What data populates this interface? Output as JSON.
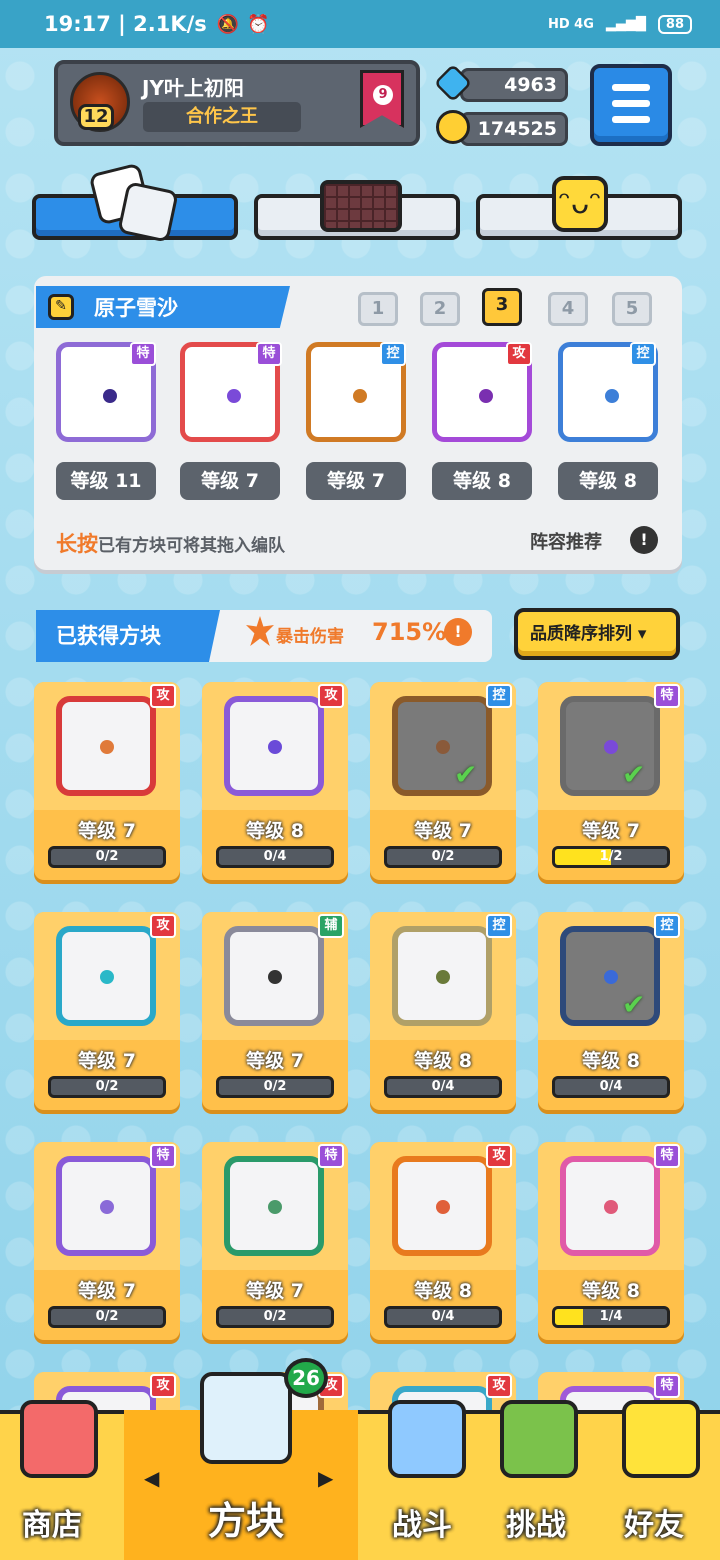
{
  "status": {
    "time_speed": "19:17 | 2.1K/s",
    "network": "HD 4G",
    "battery": "88"
  },
  "profile": {
    "name": "JY叶上初阳",
    "title": "合作之王",
    "level": "12",
    "rank": "9"
  },
  "currency": {
    "gems": "4963",
    "coins": "174525"
  },
  "deck": {
    "name": "原子雪沙",
    "pages": [
      "1",
      "2",
      "3",
      "4",
      "5"
    ],
    "selected_page": "3",
    "slots": [
      {
        "tag": "特",
        "level": "等级 11"
      },
      {
        "tag": "特",
        "level": "等级 7"
      },
      {
        "tag": "控",
        "level": "等级 7"
      },
      {
        "tag": "攻",
        "level": "等级 8"
      },
      {
        "tag": "控",
        "level": "等级 8"
      }
    ],
    "hint_key": "长按",
    "hint_text": "已有方块可将其拖入编队",
    "recommend": "阵容推荐"
  },
  "owned": {
    "title": "已获得方块",
    "crit_label": "暴击伤害",
    "crit_value": "715%",
    "sort": "品质降序排列 ▾"
  },
  "cards": [
    {
      "tag": "攻",
      "level": "等级 7",
      "progress": "0/2"
    },
    {
      "tag": "攻",
      "level": "等级 8",
      "progress": "0/4"
    },
    {
      "tag": "控",
      "level": "等级 7",
      "progress": "0/2"
    },
    {
      "tag": "特",
      "level": "等级 7",
      "progress": "1/2"
    },
    {
      "tag": "攻",
      "level": "等级 7",
      "progress": "0/2"
    },
    {
      "tag": "辅",
      "level": "等级 7",
      "progress": "0/2"
    },
    {
      "tag": "控",
      "level": "等级 8",
      "progress": "0/4"
    },
    {
      "tag": "控",
      "level": "等级 8",
      "progress": "0/4"
    },
    {
      "tag": "特",
      "level": "等级 7",
      "progress": "0/2"
    },
    {
      "tag": "特",
      "level": "等级 7",
      "progress": "0/2"
    },
    {
      "tag": "攻",
      "level": "等级 8",
      "progress": "0/4"
    },
    {
      "tag": "特",
      "level": "等级 8",
      "progress": "1/4"
    },
    {
      "tag": "攻"
    },
    {
      "tag": "攻"
    },
    {
      "tag": "攻"
    },
    {
      "tag": "特"
    }
  ],
  "nav": {
    "shop": "商店",
    "blocks": "方块",
    "battle": "战斗",
    "challenge": "挑战",
    "friends": "好友",
    "badge": "26"
  }
}
